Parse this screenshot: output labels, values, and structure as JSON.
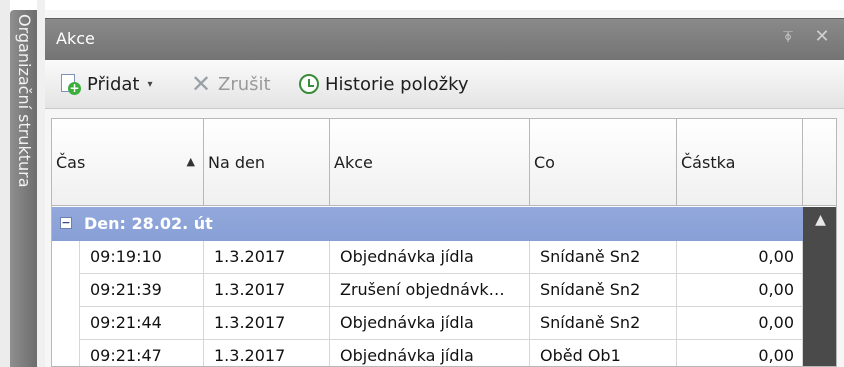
{
  "side_tab": {
    "label": "Organizační struktura"
  },
  "panel": {
    "title": "Akce",
    "pin_glyph": "⍕",
    "close_glyph": "✕"
  },
  "toolbar": {
    "add_label": "Přidat",
    "add_caret": "▾",
    "cancel_label": "Zrušit",
    "history_label": "Historie položky"
  },
  "grid": {
    "columns": [
      "Čas",
      "Na den",
      "Akce",
      "Co",
      "Částka"
    ],
    "sort_glyph": "▲",
    "group": {
      "label": "Den: 28.02. út",
      "toggle": "−"
    },
    "rows": [
      [
        "09:19:10",
        "1.3.2017",
        "Objednávka jídla",
        "Snídaně Sn2",
        "0,00"
      ],
      [
        "09:21:39",
        "1.3.2017",
        "Zrušení objednávk…",
        "Snídaně Sn2",
        "0,00"
      ],
      [
        "09:21:44",
        "1.3.2017",
        "Objednávka jídla",
        "Snídaně Sn2",
        "0,00"
      ],
      [
        "09:21:47",
        "1.3.2017",
        "Objednávka jídla",
        "Oběd Ob1",
        "0,00"
      ]
    ],
    "scroll_up_glyph": "▲"
  }
}
